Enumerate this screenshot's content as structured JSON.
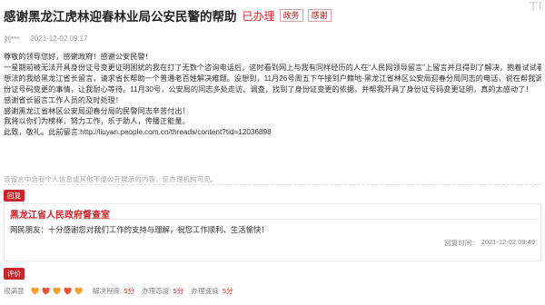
{
  "header": {
    "title": "感谢黑龙江虎林迎春林业局公安民警的帮助",
    "status": "已办理",
    "tags": [
      "政务",
      "感谢"
    ],
    "brand_mark": "TI"
  },
  "meta": {
    "author": "刘***",
    "date": "2021-12-02 09:17"
  },
  "body_lines": [
    "尊敬的领导您好，感谢政府！感谢公安民警！",
    "一星期前被无法开具身份证号变更证明困扰的我在打了无数个咨询电话后，这时看到网上与我有同样经历的人在“人民网领导留言”上留言并且得到了解决，抱着试试看的",
    "想法的我给黑龙江省长留言，请求省长帮助一个普通老百姓解决难题。没想到，11月26号周五下午接到户籍地-黑龙江省林区公安局迎春分局同志的电话，说在帮我调查身",
    "份证号码变更的事情，让我耐心等待。11月30号，公安局的同志多处走访、调查，找到了身份证变更的依据，并帮我开具了身份证号码变更证明，真的太感动了！",
    "感谢省长留言工作人员的及时处理！",
    "感谢黑龙江省林区公安局迎春分局的民警同志辛苦付出！",
    "我将以你们为榜样，努力工作，乐于助人，传播正能量。",
    "此致，敬礼。此前留言:http://liuyan.people.com.cn/threads/content?tid=12036898"
  ],
  "notice": "该留言中含有个人信息或其他不便公开展示的内容，仅办理机构可见。",
  "reply": {
    "badge": "回复",
    "org": "黑龙江省人民政府督查室",
    "text": "网民朋友：十分感谢您对我们工作的支持与理解，祝您工作顺利、生活愉快！",
    "time_label": "回复时间：",
    "time": "2021-12-02 09:49"
  },
  "rating": {
    "badge": "评价",
    "label": "很满意",
    "hearts": 5,
    "colors": {
      "heart_fill": "#f29d2c",
      "heart_alt": "#e8533b"
    },
    "items": [
      {
        "label": "解决程度:",
        "value": "5分"
      },
      {
        "label": "办理态度:",
        "value": "5分"
      },
      {
        "label": "办理速度:",
        "value": "5分"
      }
    ]
  }
}
